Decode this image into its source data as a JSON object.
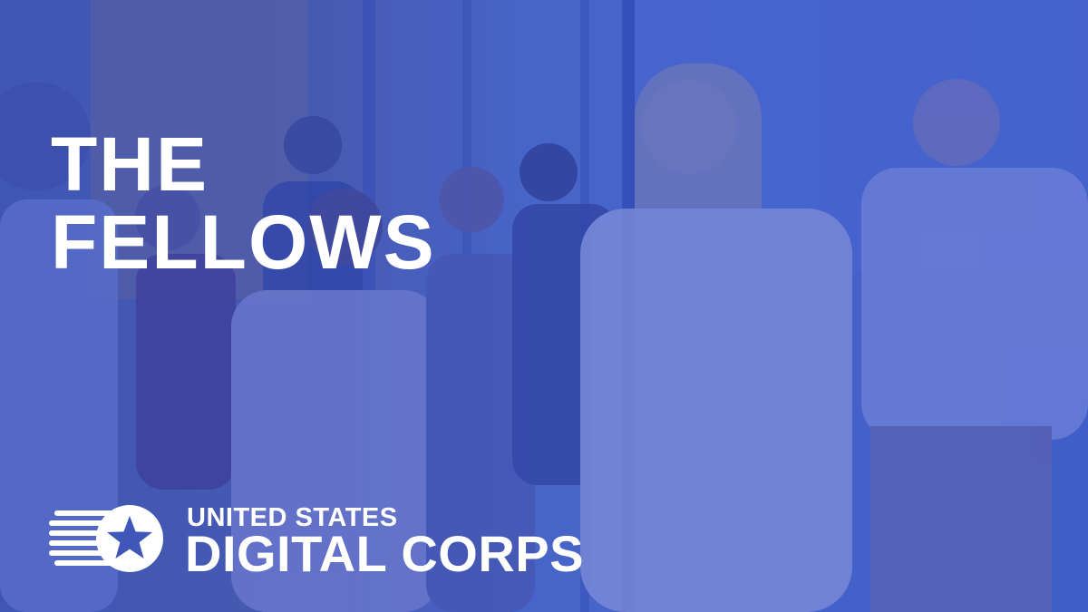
{
  "headline": {
    "line1": "THE",
    "line2": "FELLOWS"
  },
  "logo": {
    "line1": "UNITED STATES",
    "line2": "DIGITAL CORPS",
    "icon": "star-emblem-icon"
  },
  "colors": {
    "overlay": "#3f57b8",
    "text": "#ffffff"
  },
  "background": {
    "icon": "group-photo-background"
  }
}
